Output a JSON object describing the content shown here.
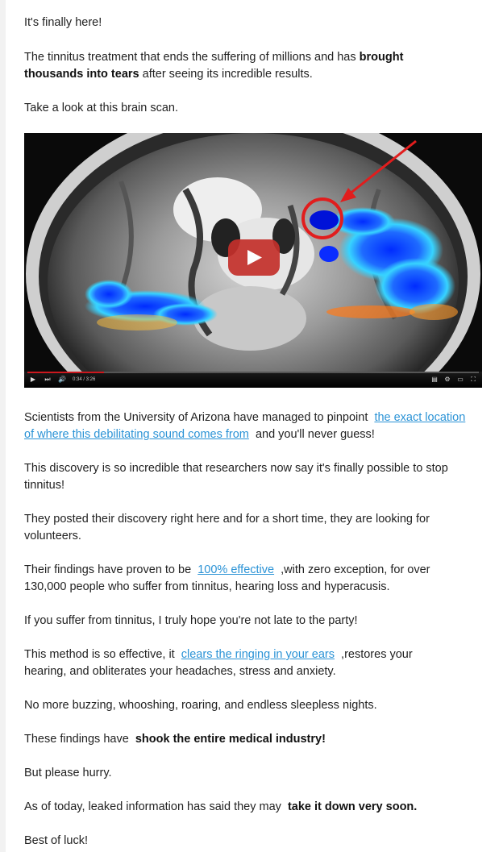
{
  "email": {
    "p1": "It's finally here!",
    "p2_pre": "The tinnitus treatment that ends the suffering of millions and has",
    "p2_bold": "brought thousands into tears",
    "p2_post": "after seeing its incredible results.",
    "p3": "Take a look at this brain scan.",
    "p4_pre": "Scientists from the University of Arizona have managed to pinpoint",
    "p4_link": "the exact location of where this debilitating sound comes from",
    "p4_post": "and you'll never guess!",
    "p5": "This discovery is so incredible that researchers now say it's finally possible to stop tinnitus!",
    "p6": "They posted their discovery right here and for a short time, they are looking for volunteers.",
    "p7_pre": "Their findings have proven to be",
    "p7_link": "100% effective",
    "p7_post": ",with zero exception, for over 130,000 people who suffer from tinnitus, hearing loss and hyperacusis.",
    "p8": "If you suffer from tinnitus, I truly hope you're not late to the party!",
    "p9_pre": "This method is so effective, it",
    "p9_link": "clears the ringing in your ears",
    "p9_post": ",restores your hearing, and obliterates your headaches, stress and anxiety.",
    "p10": "No more buzzing, whooshing, roaring, and endless sleepless nights.",
    "p11_pre": "These findings have",
    "p11_bold": "shook the entire medical industry!",
    "p12": "But please hurry.",
    "p13_pre": "As of today, leaked information has said they may",
    "p13_bold": "take it down very soon.",
    "p14": "Best of luck!"
  },
  "video": {
    "time": "0:34 / 3:26",
    "progress": 0.17,
    "play_icon": "play-icon",
    "accent": "#c4302b"
  },
  "colors": {
    "link": "#2b93d6",
    "text": "#222222"
  }
}
